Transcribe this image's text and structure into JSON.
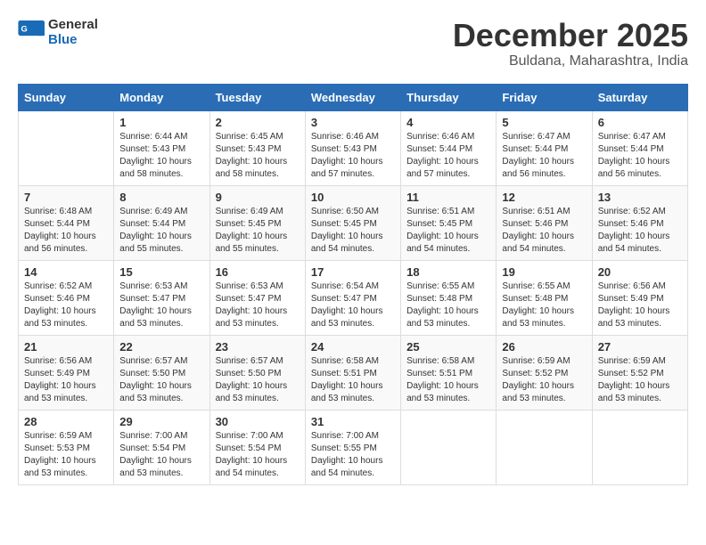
{
  "header": {
    "logo_line1": "General",
    "logo_line2": "Blue",
    "month": "December 2025",
    "location": "Buldana, Maharashtra, India"
  },
  "days_of_week": [
    "Sunday",
    "Monday",
    "Tuesday",
    "Wednesday",
    "Thursday",
    "Friday",
    "Saturday"
  ],
  "weeks": [
    [
      {
        "day": "",
        "info": ""
      },
      {
        "day": "1",
        "info": "Sunrise: 6:44 AM\nSunset: 5:43 PM\nDaylight: 10 hours\nand 58 minutes."
      },
      {
        "day": "2",
        "info": "Sunrise: 6:45 AM\nSunset: 5:43 PM\nDaylight: 10 hours\nand 58 minutes."
      },
      {
        "day": "3",
        "info": "Sunrise: 6:46 AM\nSunset: 5:43 PM\nDaylight: 10 hours\nand 57 minutes."
      },
      {
        "day": "4",
        "info": "Sunrise: 6:46 AM\nSunset: 5:44 PM\nDaylight: 10 hours\nand 57 minutes."
      },
      {
        "day": "5",
        "info": "Sunrise: 6:47 AM\nSunset: 5:44 PM\nDaylight: 10 hours\nand 56 minutes."
      },
      {
        "day": "6",
        "info": "Sunrise: 6:47 AM\nSunset: 5:44 PM\nDaylight: 10 hours\nand 56 minutes."
      }
    ],
    [
      {
        "day": "7",
        "info": "Sunrise: 6:48 AM\nSunset: 5:44 PM\nDaylight: 10 hours\nand 56 minutes."
      },
      {
        "day": "8",
        "info": "Sunrise: 6:49 AM\nSunset: 5:44 PM\nDaylight: 10 hours\nand 55 minutes."
      },
      {
        "day": "9",
        "info": "Sunrise: 6:49 AM\nSunset: 5:45 PM\nDaylight: 10 hours\nand 55 minutes."
      },
      {
        "day": "10",
        "info": "Sunrise: 6:50 AM\nSunset: 5:45 PM\nDaylight: 10 hours\nand 54 minutes."
      },
      {
        "day": "11",
        "info": "Sunrise: 6:51 AM\nSunset: 5:45 PM\nDaylight: 10 hours\nand 54 minutes."
      },
      {
        "day": "12",
        "info": "Sunrise: 6:51 AM\nSunset: 5:46 PM\nDaylight: 10 hours\nand 54 minutes."
      },
      {
        "day": "13",
        "info": "Sunrise: 6:52 AM\nSunset: 5:46 PM\nDaylight: 10 hours\nand 54 minutes."
      }
    ],
    [
      {
        "day": "14",
        "info": "Sunrise: 6:52 AM\nSunset: 5:46 PM\nDaylight: 10 hours\nand 53 minutes."
      },
      {
        "day": "15",
        "info": "Sunrise: 6:53 AM\nSunset: 5:47 PM\nDaylight: 10 hours\nand 53 minutes."
      },
      {
        "day": "16",
        "info": "Sunrise: 6:53 AM\nSunset: 5:47 PM\nDaylight: 10 hours\nand 53 minutes."
      },
      {
        "day": "17",
        "info": "Sunrise: 6:54 AM\nSunset: 5:47 PM\nDaylight: 10 hours\nand 53 minutes."
      },
      {
        "day": "18",
        "info": "Sunrise: 6:55 AM\nSunset: 5:48 PM\nDaylight: 10 hours\nand 53 minutes."
      },
      {
        "day": "19",
        "info": "Sunrise: 6:55 AM\nSunset: 5:48 PM\nDaylight: 10 hours\nand 53 minutes."
      },
      {
        "day": "20",
        "info": "Sunrise: 6:56 AM\nSunset: 5:49 PM\nDaylight: 10 hours\nand 53 minutes."
      }
    ],
    [
      {
        "day": "21",
        "info": "Sunrise: 6:56 AM\nSunset: 5:49 PM\nDaylight: 10 hours\nand 53 minutes."
      },
      {
        "day": "22",
        "info": "Sunrise: 6:57 AM\nSunset: 5:50 PM\nDaylight: 10 hours\nand 53 minutes."
      },
      {
        "day": "23",
        "info": "Sunrise: 6:57 AM\nSunset: 5:50 PM\nDaylight: 10 hours\nand 53 minutes."
      },
      {
        "day": "24",
        "info": "Sunrise: 6:58 AM\nSunset: 5:51 PM\nDaylight: 10 hours\nand 53 minutes."
      },
      {
        "day": "25",
        "info": "Sunrise: 6:58 AM\nSunset: 5:51 PM\nDaylight: 10 hours\nand 53 minutes."
      },
      {
        "day": "26",
        "info": "Sunrise: 6:59 AM\nSunset: 5:52 PM\nDaylight: 10 hours\nand 53 minutes."
      },
      {
        "day": "27",
        "info": "Sunrise: 6:59 AM\nSunset: 5:52 PM\nDaylight: 10 hours\nand 53 minutes."
      }
    ],
    [
      {
        "day": "28",
        "info": "Sunrise: 6:59 AM\nSunset: 5:53 PM\nDaylight: 10 hours\nand 53 minutes."
      },
      {
        "day": "29",
        "info": "Sunrise: 7:00 AM\nSunset: 5:54 PM\nDaylight: 10 hours\nand 53 minutes."
      },
      {
        "day": "30",
        "info": "Sunrise: 7:00 AM\nSunset: 5:54 PM\nDaylight: 10 hours\nand 54 minutes."
      },
      {
        "day": "31",
        "info": "Sunrise: 7:00 AM\nSunset: 5:55 PM\nDaylight: 10 hours\nand 54 minutes."
      },
      {
        "day": "",
        "info": ""
      },
      {
        "day": "",
        "info": ""
      },
      {
        "day": "",
        "info": ""
      }
    ]
  ]
}
